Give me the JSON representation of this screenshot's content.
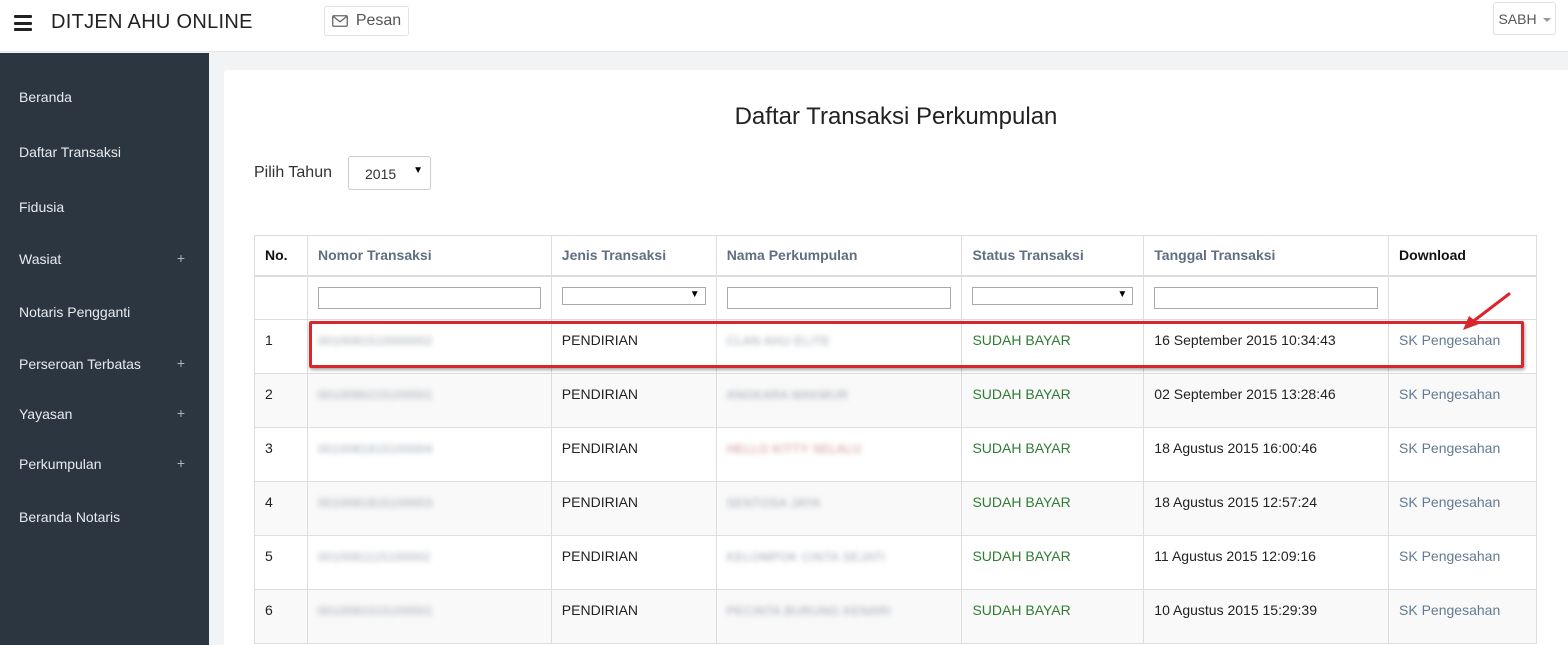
{
  "header": {
    "app_title": "DITJEN AHU ONLINE",
    "pesan_label": "Pesan",
    "user_label": "SABH"
  },
  "sidebar": {
    "items": [
      {
        "label": "Beranda",
        "expandable": false
      },
      {
        "label": "Daftar Transaksi",
        "expandable": false
      },
      {
        "label": "Fidusia",
        "expandable": false
      },
      {
        "label": "Wasiat",
        "expandable": true
      },
      {
        "label": "Notaris Pengganti",
        "expandable": false
      },
      {
        "label": "Perseroan Terbatas",
        "expandable": true
      },
      {
        "label": "Yayasan",
        "expandable": true
      },
      {
        "label": "Perkumpulan",
        "expandable": true
      },
      {
        "label": "Beranda Notaris",
        "expandable": false
      }
    ],
    "plus_symbol": "+"
  },
  "main": {
    "title": "Daftar Transaksi Perkumpulan",
    "year_label": "Pilih Tahun",
    "year_value": "2015",
    "table": {
      "columns": [
        "No.",
        "Nomor Transaksi",
        "Jenis Transaksi",
        "Nama Perkumpulan",
        "Status Transaksi",
        "Tanggal Transaksi",
        "Download"
      ],
      "rows": [
        {
          "no": "1",
          "nomor": "0010091510000002",
          "jenis": "PENDIRIAN",
          "nama": "CLAN AHU ELITE",
          "status": "SUDAH BAYAR",
          "tanggal": "16 September 2015 10:34:43",
          "download": "SK Pengesahan"
        },
        {
          "no": "2",
          "nomor": "0010090215100001",
          "jenis": "PENDIRIAN",
          "nama": "ANGKARA MAKMUR",
          "status": "SUDAH BAYAR",
          "tanggal": "02 September 2015 13:28:46",
          "download": "SK Pengesahan"
        },
        {
          "no": "3",
          "nomor": "0010081815100004",
          "jenis": "PENDIRIAN",
          "nama": "HELLO KITTY SELALU",
          "status": "SUDAH BAYAR",
          "tanggal": "18 Agustus 2015 16:00:46",
          "download": "SK Pengesahan"
        },
        {
          "no": "4",
          "nomor": "0010081815100003",
          "jenis": "PENDIRIAN",
          "nama": "SENTOSA JAYA",
          "status": "SUDAH BAYAR",
          "tanggal": "18 Agustus 2015 12:57:24",
          "download": "SK Pengesahan"
        },
        {
          "no": "5",
          "nomor": "0010081115100002",
          "jenis": "PENDIRIAN",
          "nama": "KELOMPOK CINTA SEJATI",
          "status": "SUDAH BAYAR",
          "tanggal": "11 Agustus 2015 12:09:16",
          "download": "SK Pengesahan"
        },
        {
          "no": "6",
          "nomor": "0010081015100001",
          "jenis": "PENDIRIAN",
          "nama": "PECINTA BURUNG KENARI",
          "status": "SUDAH BAYAR",
          "tanggal": "10 Agustus 2015 15:29:39",
          "download": "SK Pengesahan"
        }
      ]
    }
  },
  "colors": {
    "sidebar_bg": "#2c3640",
    "status_green": "#2e7d32",
    "link": "#627a91",
    "annotation_red": "#d9262c"
  }
}
